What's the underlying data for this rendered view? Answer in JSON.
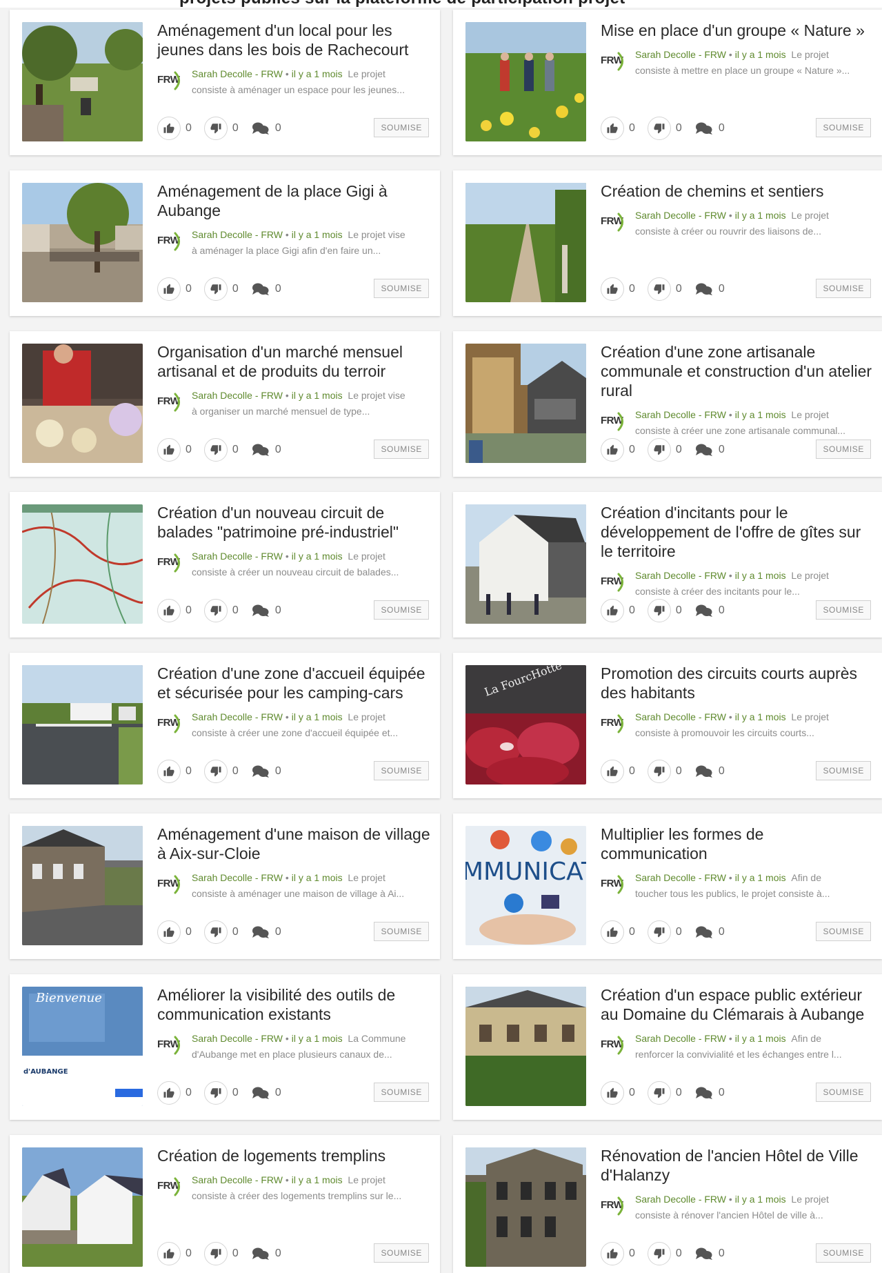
{
  "header": {
    "partial_title": "projets publiés sur la plateforme de participation projet"
  },
  "colors": {
    "accent_green": "#5f8a2e",
    "badge_border": "#d0d0d0",
    "page_background": "#f3f3f3"
  },
  "cards": [
    {
      "title": "Aménagement d'un local pour les jeunes dans les bois de Rachecourt",
      "author": "Sarah Decolle - FRW",
      "time": "il y a 1 mois",
      "excerpt_1": "Le projet",
      "excerpt_2": "consiste à aménager un espace pour les jeunes...",
      "likes": "0",
      "dislikes": "0",
      "comments": "0",
      "status": "SOUMISE",
      "image": "park-photo"
    },
    {
      "title": "Mise en place d'un groupe « Nature »",
      "author": "Sarah Decolle - FRW",
      "time": "il y a 1 mois",
      "excerpt_1": "Le projet",
      "excerpt_2": "consiste à mettre en place un groupe « Nature »...",
      "likes": "0",
      "dislikes": "0",
      "comments": "0",
      "status": "SOUMISE",
      "image": "meadow-photo"
    },
    {
      "title": "Aménagement de la place Gigi à Aubange",
      "author": "Sarah Decolle - FRW",
      "time": "il y a 1 mois",
      "excerpt_1": "Le projet vise",
      "excerpt_2": "à aménager la place Gigi afin d'en faire un...",
      "likes": "0",
      "dislikes": "0",
      "comments": "0",
      "status": "SOUMISE",
      "image": "square-photo"
    },
    {
      "title": "Création de chemins et sentiers",
      "author": "Sarah Decolle - FRW",
      "time": "il y a 1 mois",
      "excerpt_1": "Le projet",
      "excerpt_2": "consiste à créer ou rouvrir des liaisons de...",
      "likes": "0",
      "dislikes": "0",
      "comments": "0",
      "status": "SOUMISE",
      "image": "path-photo"
    },
    {
      "title": "Organisation d'un marché mensuel artisanal et de produits du terroir",
      "author": "Sarah Decolle - FRW",
      "time": "il y a 1 mois",
      "excerpt_1": "Le projet vise",
      "excerpt_2": "à organiser un marché mensuel de type...",
      "likes": "0",
      "dislikes": "0",
      "comments": "0",
      "status": "SOUMISE",
      "image": "market-photo"
    },
    {
      "title": "Création d'une zone artisanale communale et construction d'un atelier rural",
      "author": "Sarah Decolle - FRW",
      "time": "il y a 1 mois",
      "excerpt_1": "Le projet",
      "excerpt_2": "consiste à créer une zone artisanale communal...",
      "likes": "0",
      "dislikes": "0",
      "comments": "0",
      "status": "SOUMISE",
      "image": "workshop-photo"
    },
    {
      "title": "Création d'un nouveau circuit de balades \"patrimoine pré-industriel\"",
      "author": "Sarah Decolle - FRW",
      "time": "il y a 1 mois",
      "excerpt_1": "Le projet",
      "excerpt_2": "consiste à créer un nouveau circuit de balades...",
      "likes": "0",
      "dislikes": "0",
      "comments": "0",
      "status": "SOUMISE",
      "image": "map-photo"
    },
    {
      "title": "Création d'incitants pour le développement de l'offre de gîtes sur le territoire",
      "author": "Sarah Decolle - FRW",
      "time": "il y a 1 mois",
      "excerpt_1": "Le projet",
      "excerpt_2": "consiste à créer des incitants pour le...",
      "likes": "0",
      "dislikes": "0",
      "comments": "0",
      "status": "SOUMISE",
      "image": "house-photo"
    },
    {
      "title": "Création d'une zone d'accueil équipée et sécurisée pour les camping-cars",
      "author": "Sarah Decolle - FRW",
      "time": "il y a 1 mois",
      "excerpt_1": "Le projet",
      "excerpt_2": "consiste à créer une zone d'accueil équipée et...",
      "likes": "0",
      "dislikes": "0",
      "comments": "0",
      "status": "SOUMISE",
      "image": "camping-photo"
    },
    {
      "title": "Promotion des circuits courts auprès des habitants",
      "author": "Sarah Decolle - FRW",
      "time": "il y a 1 mois",
      "excerpt_1": "Le projet",
      "excerpt_2": "consiste à promouvoir les circuits courts...",
      "likes": "0",
      "dislikes": "0",
      "comments": "0",
      "status": "SOUMISE",
      "image": "meat-photo"
    },
    {
      "title": "Aménagement d'une maison de village à Aix-sur-Cloie",
      "author": "Sarah Decolle - FRW",
      "time": "il y a 1 mois",
      "excerpt_1": "Le projet",
      "excerpt_2": "consiste à aménager une maison de village à Ai...",
      "likes": "0",
      "dislikes": "0",
      "comments": "0",
      "status": "SOUMISE",
      "image": "village-house-photo"
    },
    {
      "title": "Multiplier les formes de communication",
      "author": "Sarah Decolle - FRW",
      "time": "il y a 1 mois",
      "excerpt_1": "Afin de",
      "excerpt_2": "toucher tous les publics, le projet consiste à...",
      "likes": "0",
      "dislikes": "0",
      "comments": "0",
      "status": "SOUMISE",
      "image": "communication-photo"
    },
    {
      "title": "Améliorer la visibilité des outils de communication existants",
      "author": "Sarah Decolle - FRW",
      "time": "il y a 1 mois",
      "excerpt_1": "La Commune",
      "excerpt_2": "d'Aubange met en place plusieurs canaux de...",
      "likes": "0",
      "dislikes": "0",
      "comments": "0",
      "status": "SOUMISE",
      "image": "website-photo",
      "image_text_1": "Bienvenue",
      "image_text_2": "d'AUBANGE"
    },
    {
      "title": "Création d'un espace public extérieur au Domaine du Clémarais à Aubange",
      "author": "Sarah Decolle - FRW",
      "time": "il y a 1 mois",
      "excerpt_1": "Afin de",
      "excerpt_2": "renforcer la convivialité et les échanges entre l...",
      "likes": "0",
      "dislikes": "0",
      "comments": "0",
      "status": "SOUMISE",
      "image": "domain-photo"
    },
    {
      "title": "Création de logements tremplins",
      "author": "Sarah Decolle - FRW",
      "time": "il y a 1 mois",
      "excerpt_1": "Le projet",
      "excerpt_2": "consiste à créer des logements tremplins sur le...",
      "likes": "0",
      "dislikes": "0",
      "comments": "0",
      "status": "SOUMISE",
      "image": "housing-photo"
    },
    {
      "title": "Rénovation de l'ancien Hôtel de Ville d'Halanzy",
      "author": "Sarah Decolle - FRW",
      "time": "il y a 1 mois",
      "excerpt_1": "Le projet",
      "excerpt_2": "consiste à rénover l'ancien Hôtel de ville à...",
      "likes": "0",
      "dislikes": "0",
      "comments": "0",
      "status": "SOUMISE",
      "image": "town-hall-photo"
    }
  ]
}
